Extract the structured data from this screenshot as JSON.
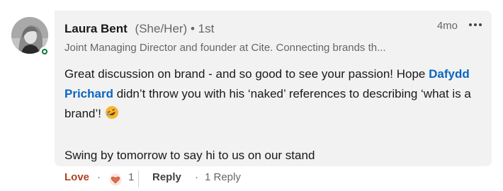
{
  "comment": {
    "author": {
      "name": "Laura Bent",
      "pronouns": "(She/Her)",
      "degree": "• 1st",
      "headline": "Joint Managing Director and founder at Cite. Connecting brands th...",
      "avatar_icon": "profile-photo",
      "status_color": "#057642"
    },
    "time": "4mo",
    "body": {
      "line1_before": "Great discussion on brand - and so good to see your passion! Hope ",
      "mention": "Dafydd Prichard",
      "line1_after": " didn’t throw you with his ‘naked’ references to describing ‘what is a brand’! ",
      "emoji_icon": "rolling-on-floor-laughing-emoji",
      "paragraph2": "Swing by tomorrow to say hi to us on our stand"
    },
    "actions": {
      "love_label": "Love",
      "separator": "·",
      "reaction_icon": "love-heart-icon",
      "reaction_count": "1",
      "reply_label": "Reply",
      "replies_label": "1 Reply"
    },
    "colors": {
      "bubble": "#f2f2f2",
      "mention": "#0a66c2",
      "love": "#b24020"
    }
  }
}
